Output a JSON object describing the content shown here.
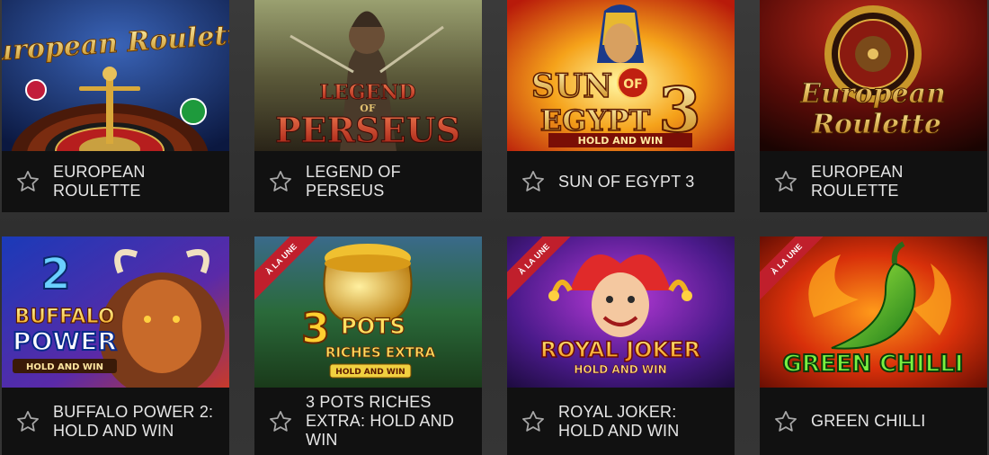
{
  "games": [
    {
      "title": "EUROPEAN ROULETTE",
      "art": "European Roulette",
      "badge": ""
    },
    {
      "title": "LEGEND OF PERSEUS",
      "art_top": "LEGEND",
      "art_mid": "OF",
      "art_bottom": "PERSEUS",
      "badge": ""
    },
    {
      "title": "SUN OF EGYPT 3",
      "art_top": "SUN",
      "art_of": "OF",
      "art_bottom": "EGYPT",
      "art_num": "3",
      "art_sub": "HOLD AND WIN",
      "badge": ""
    },
    {
      "title": "EUROPEAN ROULETTE",
      "art_top": "European",
      "art_bottom": "Roulette",
      "badge": ""
    },
    {
      "title": "BUFFALO POWER 2: HOLD AND WIN",
      "art_num": "2",
      "art_top": "BUFFALO",
      "art_bottom": "POWER",
      "art_sub": "HOLD AND WIN",
      "badge": ""
    },
    {
      "title": "3 POTS RICHES EXTRA: HOLD AND WIN",
      "art_num": "3",
      "art_top": "POTS",
      "art_bottom": "RICHES EXTRA",
      "art_sub": "HOLD AND WIN",
      "badge": "À LA UNE"
    },
    {
      "title": "ROYAL JOKER: HOLD AND WIN",
      "art_top": "ROYAL JOKER",
      "art_sub": "HOLD AND WIN",
      "badge": "À LA UNE"
    },
    {
      "title": "GREEN CHILLI",
      "art_top": "GREEN CHILLI",
      "badge": "À LA UNE"
    }
  ],
  "icons": {
    "favorite": "star-outline-icon"
  },
  "colors": {
    "card_bar": "#111111",
    "title_text": "#e6e6e6",
    "ribbon": "#c01f2c"
  }
}
